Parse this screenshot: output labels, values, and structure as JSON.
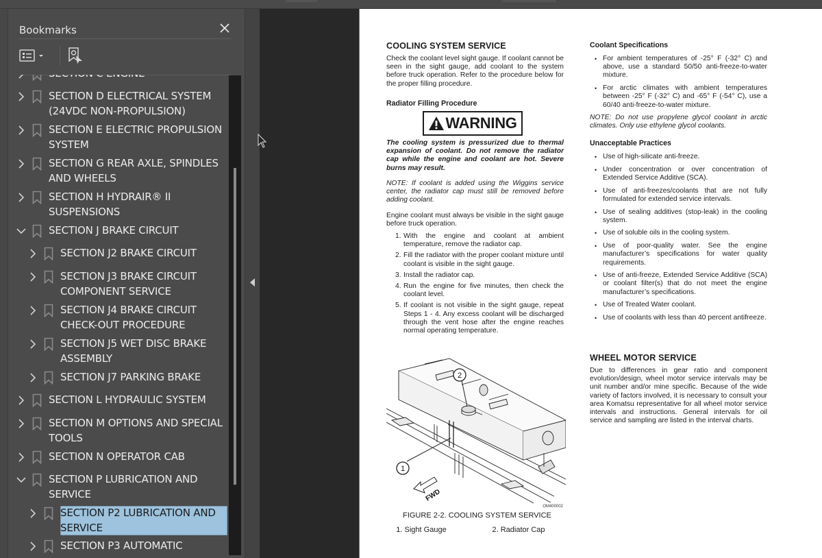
{
  "panel": {
    "title": "Bookmarks",
    "close_icon": "close-icon",
    "toolbar": {
      "options_icon": "list-options-icon",
      "dropdown_icon": "caret-down-icon",
      "find_bookmark_icon": "find-current-bookmark-icon"
    }
  },
  "bookmarks": [
    {
      "label": "SECTION C ENGINE",
      "level": 0,
      "state": "collapsed"
    },
    {
      "label": "SECTION D ELECTRICAL SYSTEM (24VDC NON-PROPULSION)",
      "level": 0,
      "state": "collapsed"
    },
    {
      "label": "SECTION E ELECTRIC PROPULSION SYSTEM",
      "level": 0,
      "state": "collapsed"
    },
    {
      "label": "SECTION G REAR AXLE, SPINDLES AND WHEELS",
      "level": 0,
      "state": "collapsed"
    },
    {
      "label": "SECTION H HYDRAIR® II SUSPENSIONS",
      "level": 0,
      "state": "collapsed"
    },
    {
      "label": "SECTION J BRAKE CIRCUIT",
      "level": 0,
      "state": "expanded"
    },
    {
      "label": "SECTION J2 BRAKE CIRCUIT",
      "level": 1,
      "state": "collapsed"
    },
    {
      "label": "SECTION J3 BRAKE CIRCUIT COMPONENT SERVICE",
      "level": 1,
      "state": "collapsed"
    },
    {
      "label": "SECTION J4 BRAKE CIRCUIT CHECK-OUT PROCEDURE",
      "level": 1,
      "state": "collapsed"
    },
    {
      "label": "SECTION J5 WET DISC BRAKE ASSEMBLY",
      "level": 1,
      "state": "collapsed"
    },
    {
      "label": "SECTION J7 PARKING BRAKE",
      "level": 1,
      "state": "collapsed"
    },
    {
      "label": "SECTION L HYDRAULIC SYSTEM",
      "level": 0,
      "state": "collapsed"
    },
    {
      "label": "SECTION M OPTIONS AND SPECIAL TOOLS",
      "level": 0,
      "state": "collapsed"
    },
    {
      "label": "SECTION N OPERATOR CAB",
      "level": 0,
      "state": "collapsed"
    },
    {
      "label": "SECTION P LUBRICATION AND SERVICE",
      "level": 0,
      "state": "expanded"
    },
    {
      "label": "SECTION P2 LUBRICATION AND SERVICE",
      "level": 1,
      "state": "collapsed",
      "selected": true
    },
    {
      "label": "SECTION P3 AUTOMATIC",
      "level": 1,
      "state": "collapsed"
    }
  ],
  "colors": {
    "panel_bg": "#4b4b4b",
    "canvas_bg": "#282828",
    "selection": "#9dc3de",
    "page_bg": "#ffffff"
  },
  "document": {
    "left": {
      "heading": "COOLING SYSTEM SERVICE",
      "intro": "Check the coolant level sight gauge. If coolant cannot be seen in the sight gauge, add coolant to the system before truck operation. Refer to the procedure below for the proper filling procedure.",
      "subheading": "Radiator Filling Procedure",
      "warning_label": "WARNING",
      "warning_text": "The cooling system is pressurized due to thermal expansion of coolant. Do not remove the radiator cap while the engine and coolant are hot. Severe burns may result.",
      "note": "NOTE: If coolant is added using the Wiggins service center, the radiator cap must still be removed before adding coolant.",
      "para": "Engine coolant must always be visible in the sight gauge before truck operation.",
      "steps": [
        {
          "num": "1.",
          "text": "With the engine and coolant at ambient temperature, remove the radiator cap."
        },
        {
          "num": "2.",
          "text": "Fill the radiator with the proper coolant mixture until coolant is visible in the sight gauge."
        },
        {
          "num": "3.",
          "text": "Install the radiator cap."
        },
        {
          "num": "4.",
          "text": "Run the engine for five minutes, then check the coolant level."
        },
        {
          "num": "5.",
          "text": "If coolant is not visible in the sight gauge, repeat Steps 1 - 4. Any excess coolant will be discharged through the vent hose after the engine reaches normal operating temperature."
        }
      ],
      "figure": {
        "callout_1": "1",
        "callout_2": "2",
        "fwd": "FWD",
        "code": "OM400002",
        "caption": "FIGURE 2-2. COOLING SYSTEM SERVICE",
        "legend_1": "1. Sight Gauge",
        "legend_2": "2. Radiator Cap"
      }
    },
    "right": {
      "spec_heading": "Coolant Specifications",
      "spec_items": [
        "For ambient temperatures of -25° F (-32° C) and above, use a standard 50/50 anti-freeze-to-water mixture.",
        "For arctic climates with ambient temperatures between -25° F (-32° C) and -65° F (-54° C), use a 60/40 anti-freeze-to-water mixture."
      ],
      "spec_note": "NOTE: Do not use propylene glycol coolant in arctic climates. Only use ethylene glycol coolants.",
      "unacceptable_heading": "Unacceptable Practices",
      "unacceptable_items": [
        "Use of high-silicate anti-freeze.",
        "Under concentration or over concentration of Extended Service Additive (SCA).",
        "Use of anti-freezes/coolants that are not fully formulated for extended service intervals.",
        "Use of sealing additives (stop-leak) in the cooling system.",
        "Use of soluble oils in the cooling system.",
        "Use of poor-quality water. See the engine manufacturer’s specifications for water quality requirements.",
        "Use of anti-freeze, Extended Service Additive (SCA) or coolant filter(s) that do not meet the engine manufacturer’s specifications.",
        "Use of Treated Water coolant.",
        "Use of coolants with less than 40 percent antifreeze."
      ],
      "wheel_heading": "WHEEL MOTOR SERVICE",
      "wheel_text": "Due to differences in gear ratio and component evolution/design, wheel motor service intervals may be unit number and/or mine specific. Because of the wide variety of factors involved, it is necessary to consult your area Komatsu representative for all wheel motor service intervals and instructions. General intervals for oil service and sampling are listed in the interval charts."
    }
  }
}
